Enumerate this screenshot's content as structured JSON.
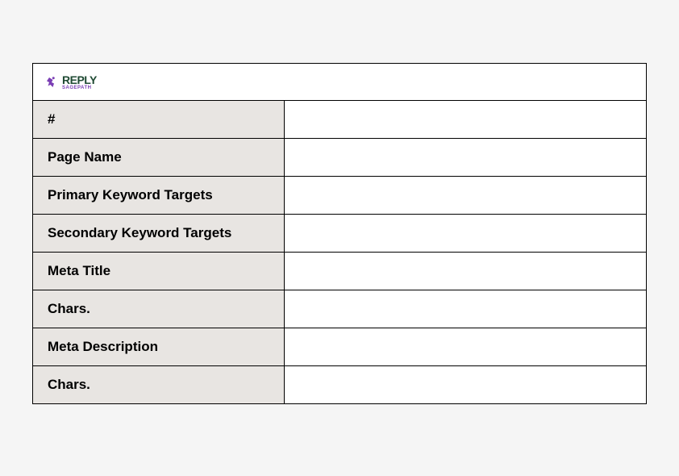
{
  "logo": {
    "main": "REPLY",
    "sub": "SAGEPATH"
  },
  "rows": [
    {
      "label": "#",
      "value": ""
    },
    {
      "label": "Page Name",
      "value": ""
    },
    {
      "label": "Primary Keyword Targets",
      "value": ""
    },
    {
      "label": "Secondary Keyword Targets",
      "value": ""
    },
    {
      "label": "Meta Title",
      "value": ""
    },
    {
      "label": "Chars.",
      "value": ""
    },
    {
      "label": "Meta Description",
      "value": ""
    },
    {
      "label": "Chars.",
      "value": ""
    }
  ]
}
